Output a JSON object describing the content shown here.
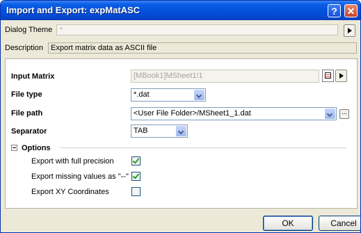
{
  "window": {
    "title": "Import and Export: expMatASC",
    "help": "?",
    "close": "✕"
  },
  "theme": {
    "label": "Dialog Theme",
    "value": "*"
  },
  "description": {
    "label": "Description",
    "text": "Export matrix data as ASCII file"
  },
  "fields": {
    "input_matrix": {
      "label": "Input Matrix",
      "value": "[MBook1]MSheet1!1"
    },
    "file_type": {
      "label": "File type",
      "value": "*.dat"
    },
    "file_path": {
      "label": "File path",
      "value": "<User File Folder>/MSheet1_1.dat",
      "browse": "..."
    },
    "separator": {
      "label": "Separator",
      "value": "TAB"
    }
  },
  "options": {
    "header": "Options",
    "items": [
      {
        "label": "Export with full precision",
        "checked": true
      },
      {
        "label": "Export missing values as \"--\"",
        "checked": true
      },
      {
        "label": "Export XY Coordinates",
        "checked": false
      }
    ]
  },
  "buttons": {
    "ok": "OK",
    "cancel": "Cancel"
  }
}
